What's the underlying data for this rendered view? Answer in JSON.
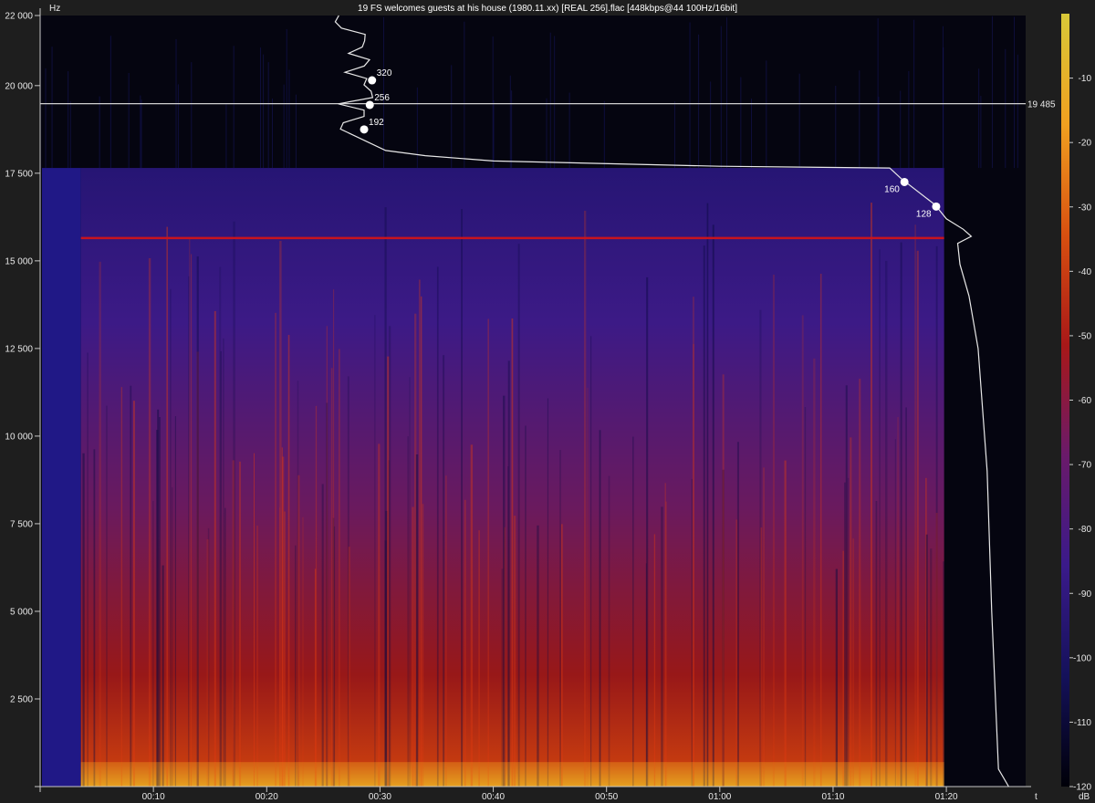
{
  "chart_data": {
    "type": "heatmap",
    "title": "19 FS welcomes guests at his house (1980.11.xx) [REAL 256].flac [448kbps@44 100Hz/16bit]",
    "y_unit": "Hz",
    "x_unit": "t",
    "colorbar_unit": "dB",
    "x_range_seconds": [
      0,
      87
    ],
    "y_range_hz": [
      0,
      22000
    ],
    "y_ticks": [
      {
        "value": 2500,
        "label": "2 500"
      },
      {
        "value": 5000,
        "label": "5 000"
      },
      {
        "value": 7500,
        "label": "7 500"
      },
      {
        "value": 10000,
        "label": "10 000"
      },
      {
        "value": 12500,
        "label": "12 500"
      },
      {
        "value": 15000,
        "label": "15 000"
      },
      {
        "value": 17500,
        "label": "17 500"
      },
      {
        "value": 20000,
        "label": "20 000"
      },
      {
        "value": 22000,
        "label": "22 000"
      }
    ],
    "x_ticks": [
      {
        "value": 10,
        "label": "00:10"
      },
      {
        "value": 20,
        "label": "00:20"
      },
      {
        "value": 30,
        "label": "00:30"
      },
      {
        "value": 40,
        "label": "00:40"
      },
      {
        "value": 50,
        "label": "00:50"
      },
      {
        "value": 60,
        "label": "01:00"
      },
      {
        "value": 70,
        "label": "01:10"
      },
      {
        "value": 80,
        "label": "01:20"
      }
    ],
    "colorbar_ticks": [
      {
        "value": -10,
        "label": "-10"
      },
      {
        "value": -20,
        "label": "-20"
      },
      {
        "value": -30,
        "label": "-30"
      },
      {
        "value": -40,
        "label": "-40"
      },
      {
        "value": -50,
        "label": "-50"
      },
      {
        "value": -60,
        "label": "-60"
      },
      {
        "value": -70,
        "label": "-70"
      },
      {
        "value": -80,
        "label": "-80"
      },
      {
        "value": -90,
        "label": "-90"
      },
      {
        "value": -100,
        "label": "-100"
      },
      {
        "value": -110,
        "label": "-110"
      },
      {
        "value": -120,
        "label": "-120"
      }
    ],
    "colorbar_range_db": [
      -120,
      0
    ],
    "colors": {
      "background": "#1e1e1e",
      "silent": "#050510",
      "colorbar_stops": [
        "#000008",
        "#14115a",
        "#3a1a8a",
        "#6a1a6a",
        "#a81818",
        "#d85010",
        "#f0a020",
        "#d8c838"
      ]
    },
    "cutoff_line": {
      "value_hz": 19485,
      "label": "19 485"
    },
    "red_line_hz": 15650,
    "content_band_hz": 17650,
    "audio_start_s": 3.6,
    "audio_end_s": 79.8,
    "bitrate_markers": [
      {
        "label": "320",
        "hz": 20150
      },
      {
        "label": "256",
        "hz": 19450
      },
      {
        "label": "192",
        "hz": 18750
      },
      {
        "label": "160",
        "hz": 17250
      },
      {
        "label": "128",
        "hz": 16550
      }
    ]
  }
}
